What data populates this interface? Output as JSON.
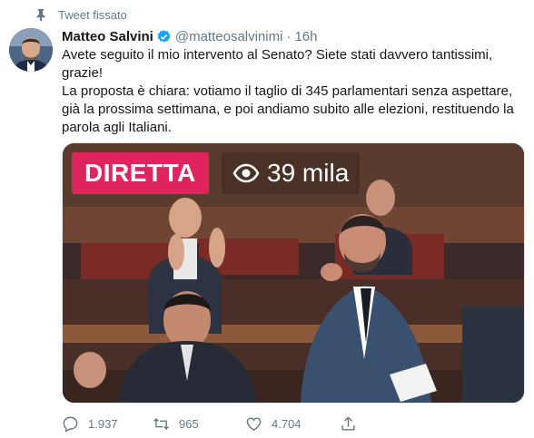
{
  "pinned": {
    "label": "Tweet fissato",
    "icon": "pin-icon"
  },
  "author": {
    "name": "Matteo Salvini",
    "handle": "@matteosalvinimi",
    "separator": "·",
    "time": "16h",
    "verified": true
  },
  "tweet": {
    "line1": "Avete seguito il mio intervento al Senato? Siete stati davvero tantissimi, grazie!",
    "line2": "La proposta è chiara: votiamo il taglio di 345 parlamentari senza aspettare, già la prossima settimana, e poi andiamo subito alle elezioni, restituendo la parola agli Italiani."
  },
  "media": {
    "live_label": "DIRETTA",
    "views": "39 mila",
    "live_color": "#e0245e"
  },
  "actions": {
    "replies": "1.937",
    "retweets": "965",
    "likes": "4.704"
  },
  "colors": {
    "accent": "#1da1f2",
    "muted": "#657786",
    "text": "#14171a"
  }
}
